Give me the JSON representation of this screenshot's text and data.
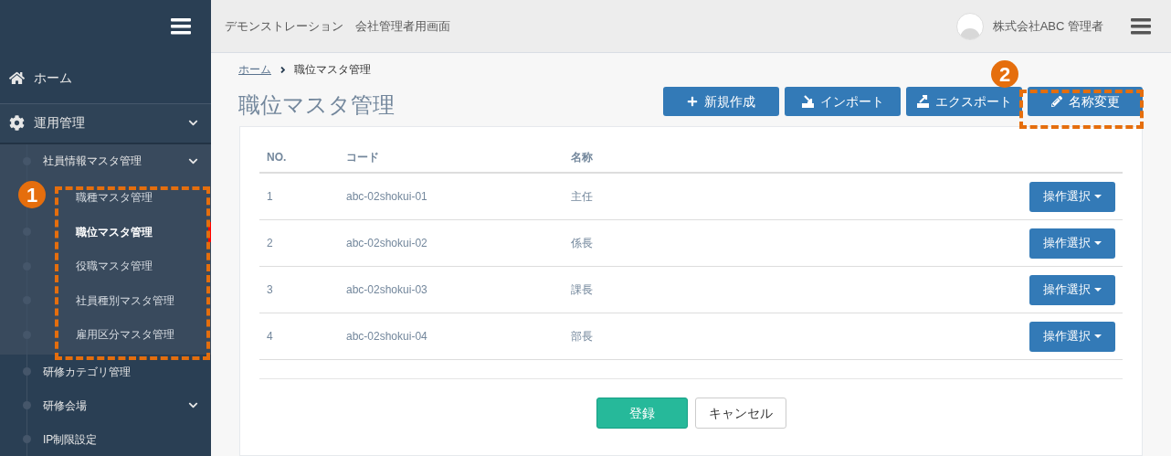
{
  "header": {
    "title": "デモンストレーション　会社管理者用画面",
    "user": "株式会社ABC 管理者"
  },
  "sidebar": {
    "items": [
      {
        "label": "ホーム",
        "kind": "home"
      },
      {
        "label": "運用管理",
        "kind": "gear",
        "expanded": true,
        "children": [
          {
            "label": "社員情報マスタ管理",
            "expanded": true,
            "children": [
              {
                "label": "職種マスタ管理",
                "selected": false
              },
              {
                "label": "職位マスタ管理",
                "selected": true
              },
              {
                "label": "役職マスタ管理",
                "selected": false
              },
              {
                "label": "社員種別マスタ管理",
                "selected": false
              },
              {
                "label": "雇用区分マスタ管理",
                "selected": false
              }
            ]
          },
          {
            "label": "研修カテゴリ管理",
            "kind": "leaf"
          },
          {
            "label": "研修会場",
            "kind": "group"
          },
          {
            "label": "IP制限設定",
            "kind": "leaf"
          }
        ]
      }
    ]
  },
  "breadcrumb": [
    "ホーム",
    "職位マスタ管理"
  ],
  "page_title": "職位マスタ管理",
  "actions": [
    {
      "label": "新規作成",
      "kind": "plus"
    },
    {
      "label": "インポート",
      "kind": "import"
    },
    {
      "label": "エクスポート",
      "kind": "export"
    },
    {
      "label": "名称変更",
      "kind": "pencil"
    }
  ],
  "table": {
    "columns": [
      "NO.",
      "コード",
      "名称"
    ],
    "rows": [
      {
        "no": "1",
        "code": "abc-02shokui-01",
        "name": "主任",
        "action": "操作選択"
      },
      {
        "no": "2",
        "code": "abc-02shokui-02",
        "name": "係長",
        "action": "操作選択"
      },
      {
        "no": "3",
        "code": "abc-02shokui-03",
        "name": "課長",
        "action": "操作選択"
      },
      {
        "no": "4",
        "code": "abc-02shokui-04",
        "name": "部長",
        "action": "操作選択"
      }
    ]
  },
  "footer_buttons": [
    {
      "label": "登録",
      "kind": "primary"
    },
    {
      "label": "キャンセル",
      "kind": "default"
    }
  ],
  "annotations": [
    "1",
    "2"
  ]
}
